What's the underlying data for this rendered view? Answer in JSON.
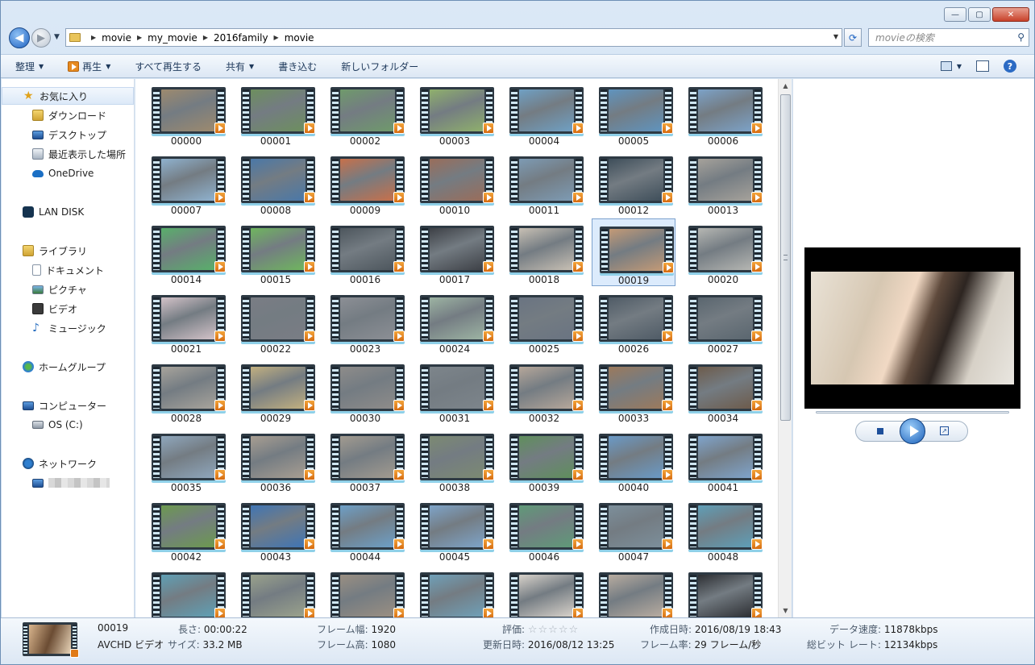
{
  "window": {
    "minimize": "—",
    "maximize": "▢",
    "close": "✕"
  },
  "address": {
    "crumbs": [
      "movie",
      "my_movie",
      "2016family",
      "movie"
    ],
    "search_placeholder": "movieの検索"
  },
  "toolbar": {
    "organize": "整理",
    "play": "再生",
    "play_all": "すべて再生する",
    "share": "共有",
    "burn": "書き込む",
    "new_folder": "新しいフォルダー"
  },
  "nav": {
    "favorites": "お気に入り",
    "downloads": "ダウンロード",
    "desktop": "デスクトップ",
    "recent": "最近表示した場所",
    "onedrive": "OneDrive",
    "lan_disk": "LAN DISK",
    "libraries": "ライブラリ",
    "documents": "ドキュメント",
    "pictures": "ピクチャ",
    "videos": "ビデオ",
    "music": "ミュージック",
    "homegroup": "ホームグループ",
    "computer": "コンピューター",
    "os_drive": "OS (C:)",
    "network": "ネットワーク"
  },
  "files": [
    {
      "name": "00000",
      "color": "#9d8a6e"
    },
    {
      "name": "00001",
      "color": "#6d8f5e"
    },
    {
      "name": "00002",
      "color": "#6f9a6b"
    },
    {
      "name": "00003",
      "color": "#8fb06c"
    },
    {
      "name": "00004",
      "color": "#6fa0c4"
    },
    {
      "name": "00005",
      "color": "#5f94bf"
    },
    {
      "name": "00006",
      "color": "#7ca2c8"
    },
    {
      "name": "00007",
      "color": "#8fb2cf"
    },
    {
      "name": "00008",
      "color": "#4a78a8"
    },
    {
      "name": "00009",
      "color": "#c8704a"
    },
    {
      "name": "00010",
      "color": "#9a6d5a"
    },
    {
      "name": "00011",
      "color": "#7d9bb4"
    },
    {
      "name": "00012",
      "color": "#3e4e5a"
    },
    {
      "name": "00013",
      "color": "#a6a29b"
    },
    {
      "name": "00014",
      "color": "#58b06a"
    },
    {
      "name": "00015",
      "color": "#6fb65e"
    },
    {
      "name": "00016",
      "color": "#4d565d"
    },
    {
      "name": "00017",
      "color": "#3d4046"
    },
    {
      "name": "00018",
      "color": "#c8c0b4"
    },
    {
      "name": "00019",
      "color": "#c49a76"
    },
    {
      "name": "00020",
      "color": "#b6b7b3"
    },
    {
      "name": "00021",
      "color": "#d4c3c9"
    },
    {
      "name": "00022",
      "color": "#7a7d84"
    },
    {
      "name": "00023",
      "color": "#8c8f95"
    },
    {
      "name": "00024",
      "color": "#9db4a3"
    },
    {
      "name": "00025",
      "color": "#6a7482"
    },
    {
      "name": "00026",
      "color": "#4f5b66"
    },
    {
      "name": "00027",
      "color": "#5a666f"
    },
    {
      "name": "00028",
      "color": "#a8a49c"
    },
    {
      "name": "00029",
      "color": "#c2b080"
    },
    {
      "name": "00030",
      "color": "#8e8c8a"
    },
    {
      "name": "00031",
      "color": "#7d858b"
    },
    {
      "name": "00032",
      "color": "#b6a79a"
    },
    {
      "name": "00033",
      "color": "#9c7a5c"
    },
    {
      "name": "00034",
      "color": "#6d5b4b"
    },
    {
      "name": "00035",
      "color": "#8fa7bd"
    },
    {
      "name": "00036",
      "color": "#a89e92"
    },
    {
      "name": "00037",
      "color": "#a29b90"
    },
    {
      "name": "00038",
      "color": "#7c8a72"
    },
    {
      "name": "00039",
      "color": "#5f8f5c"
    },
    {
      "name": "00040",
      "color": "#6a9ac7"
    },
    {
      "name": "00041",
      "color": "#7fa4cc"
    },
    {
      "name": "00042",
      "color": "#6c9a4e"
    },
    {
      "name": "00043",
      "color": "#3f75b5"
    },
    {
      "name": "00044",
      "color": "#6da0c8"
    },
    {
      "name": "00045",
      "color": "#7ea4c9"
    },
    {
      "name": "00046",
      "color": "#5f9a78"
    },
    {
      "name": "00047",
      "color": "#7c8f9b"
    },
    {
      "name": "00048",
      "color": "#5e9fb8"
    },
    {
      "name": "",
      "color": "#5fa0b5"
    },
    {
      "name": "",
      "color": "#9aa28c"
    },
    {
      "name": "",
      "color": "#9a8f82"
    },
    {
      "name": "",
      "color": "#6fa0b8"
    },
    {
      "name": "",
      "color": "#d8d2ca"
    },
    {
      "name": "",
      "color": "#b8aca0"
    },
    {
      "name": "",
      "color": "#2d2f33"
    }
  ],
  "selected_index": 19,
  "details": {
    "name": "00019",
    "type": "AVCHD ビデオ",
    "length_key": "長さ:",
    "length": "00:00:22",
    "size_key": "サイズ:",
    "size": "33.2 MB",
    "frame_width_key": "フレーム幅:",
    "frame_width": "1920",
    "frame_height_key": "フレーム高:",
    "frame_height": "1080",
    "rating_key": "評価:",
    "rating_stars": "☆☆☆☆☆",
    "modified_key": "更新日時:",
    "modified": "2016/08/12 13:25",
    "created_key": "作成日時:",
    "created": "2016/08/19 18:43",
    "frame_rate_key": "フレーム率:",
    "frame_rate": "29 フレーム/秒",
    "data_rate_key": "データ速度:",
    "data_rate": "11878kbps",
    "bitrate_key": "総ビット レート:",
    "bitrate": "12134kbps"
  }
}
